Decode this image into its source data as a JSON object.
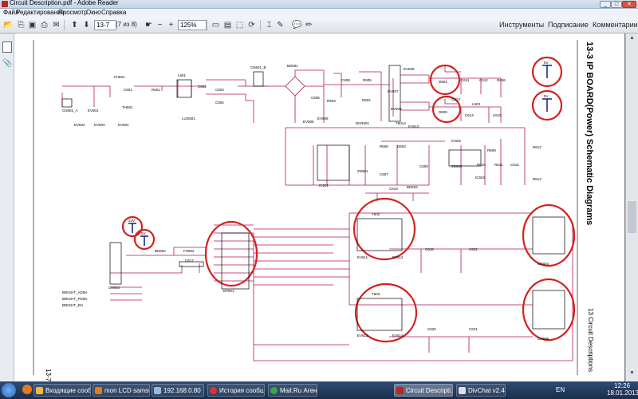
{
  "window": {
    "title": "Circuit Description.pdf - Adobe Reader"
  },
  "menu": [
    "Файл",
    "Редактирование",
    "Просмотр",
    "Окно",
    "Справка"
  ],
  "toolbar": {
    "page_box": "13-7",
    "page_of": "(7 из 8)",
    "zoom": "125%",
    "tools": "Инструменты",
    "sign": "Подписание",
    "comments": "Комментарии"
  },
  "document": {
    "heading": "13-3 IP BOARD(Power) Schematic Diagrams",
    "chapter": "13 Circuit Descriptions",
    "page_number": "13-7",
    "labels": {
      "cn601a": "CN601_A",
      "fh601": "FH601",
      "l601": "L601",
      "cn601b": "CN601_B",
      "ev601": "EV601",
      "ev602": "EV602",
      "ev603": "EV603",
      "ev604": "EV604",
      "bd601": "BD601",
      "lug601": "LUG601",
      "c601": "C601",
      "c602": "C602",
      "c603": "C603",
      "c604": "C604",
      "r601": "R601",
      "th601": "TH601",
      "c605": "C605",
      "r603": "R603",
      "ev605": "EV605",
      "ev606": "EV606",
      "r605": "R605",
      "c608": "C608",
      "d602": "D602",
      "bcr601": "BCR601",
      "ev607": "EV607",
      "ev608": "EV608",
      "t601a": "T601A",
      "ev610": "EV610",
      "ev609": "EV609",
      "d604": "D604",
      "d605": "D605",
      "c611": "C611",
      "c612": "C612",
      "r606": "R606",
      "l603": "L603",
      "c614": "C614",
      "c615": "C615",
      "c613": "C613",
      "r608": "R608",
      "d603": "D603",
      "ic602": "IC602",
      "r609": "R609",
      "r610": "R610",
      "r611": "R611",
      "c616": "C616",
      "ic603": "IC603",
      "r612": "R612",
      "r613": "R613",
      "ic601": "IC601",
      "zd601": "ZD601",
      "c607": "C607",
      "c609": "C609",
      "zd602": "ZD602",
      "c619": "C619",
      "bd603": "BD603",
      "bd602": "BD602",
      "fh602": "FH602",
      "c617": "C617",
      "cn603": "CN603",
      "ep601": "EP601",
      "t602": "T602",
      "t603": "T603",
      "ev611": "EV611",
      "ev612": "EV612",
      "ev613": "EV613",
      "ev614": "EV614",
      "c618": "C618",
      "c620": "C620",
      "c621": "C621",
      "c622": "C622",
      "cn604": "CN604",
      "cn605": "CN605",
      "bright_adim": "BRIGHT_ADIM",
      "bright_pdim": "BRIGHT_PDIM",
      "bright_en": "BRIGHT_EN",
      "v_top1": "5V",
      "v_top2": "5V",
      "v_left1": "24V",
      "v_left2": "5V"
    }
  },
  "taskbar": {
    "items": [
      "Входящие сооб...",
      "mon LCD samsun...",
      "192.168.0.80",
      "История сообщ...",
      "Mail.Ru Агент",
      "Circuit Descripti...",
      "DivChat v2.46"
    ],
    "lang": "EN",
    "time": "12:26",
    "date": "18.01.2013"
  },
  "colors": {
    "wire": "#b0185a",
    "circle": "#d42020",
    "component": "#000000"
  }
}
